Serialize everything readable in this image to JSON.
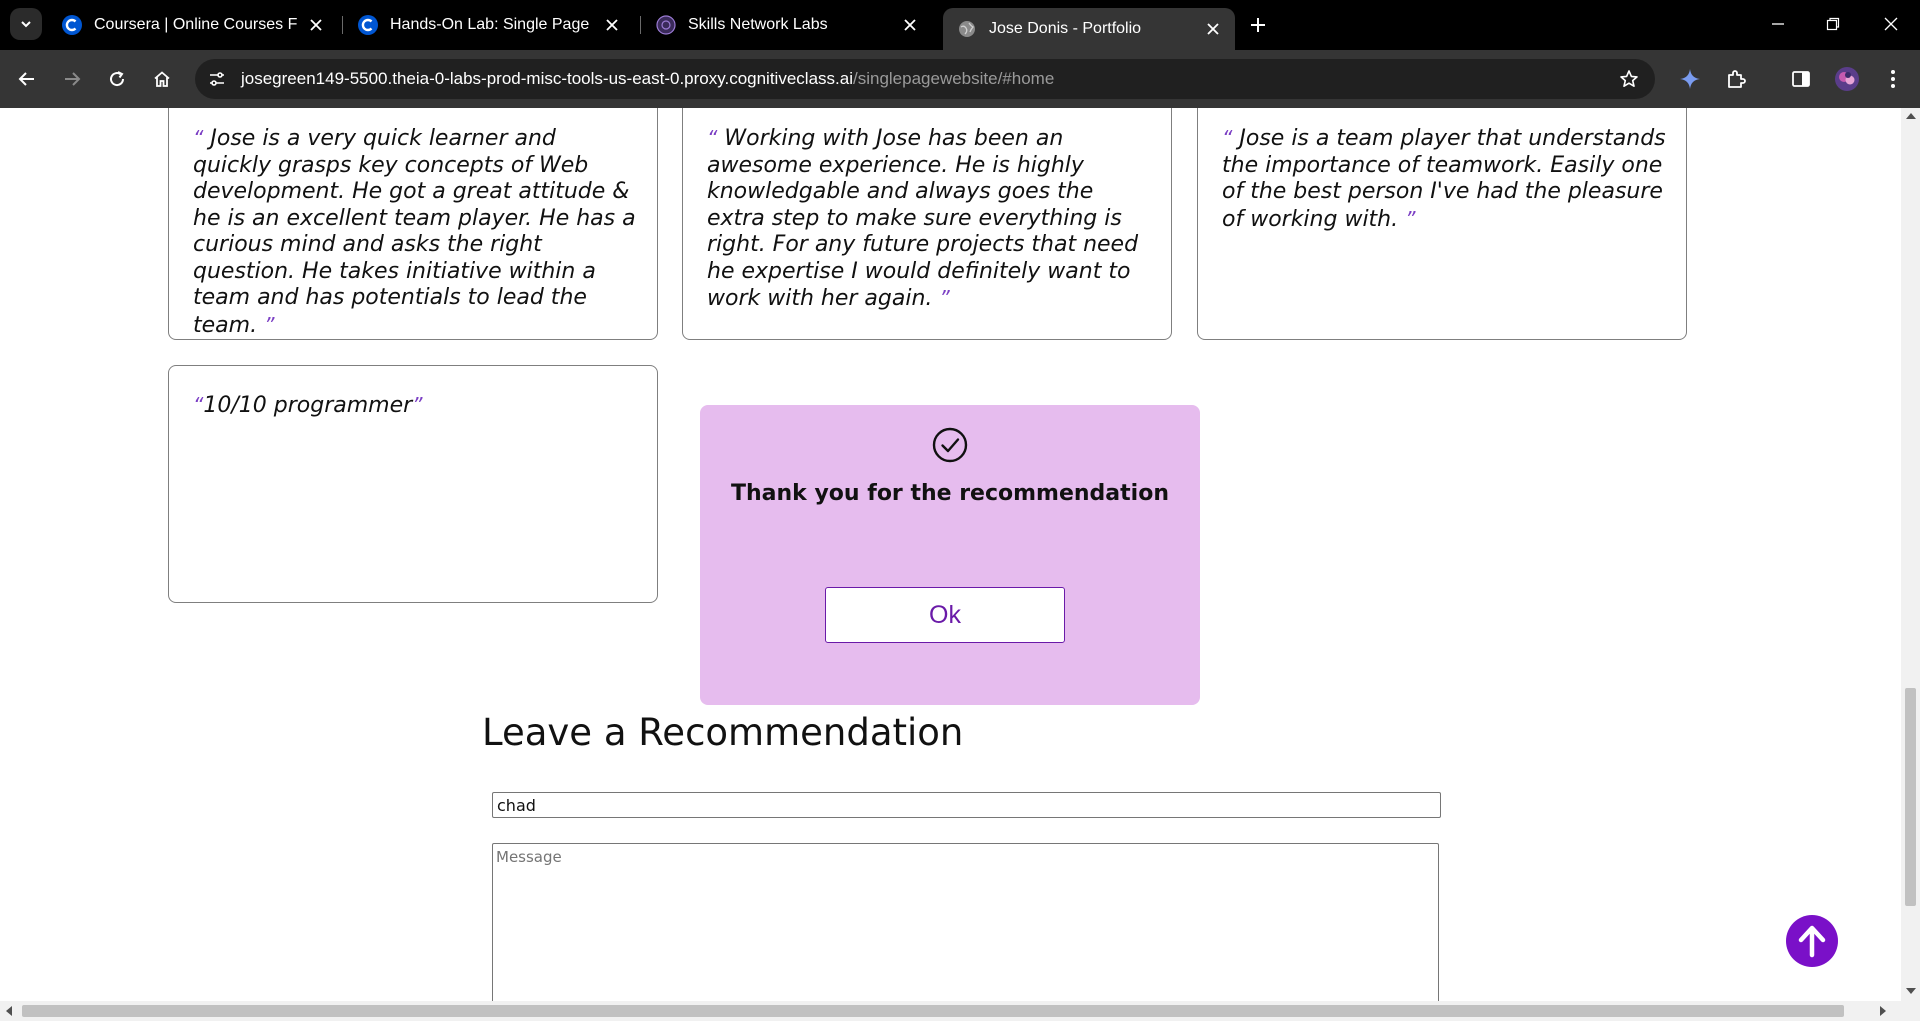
{
  "browser": {
    "tabs": [
      {
        "title": "Coursera | Online Courses From",
        "favicon": "coursera-icon"
      },
      {
        "title": "Hands-On Lab: Single Page Port",
        "favicon": "coursera-icon"
      },
      {
        "title": "Skills Network Labs",
        "favicon": "skills-network-icon"
      },
      {
        "title": "Jose Donis - Portfolio",
        "favicon": "globe-icon",
        "active": true
      }
    ],
    "url_host": "josegreen149-5500.theia-0-labs-prod-misc-tools-us-east-0.proxy.cognitiveclass.ai",
    "url_path": "/singlepagewebsite/#home"
  },
  "page": {
    "recommendations": [
      {
        "open_quote": "“",
        "text": "Jose is a very quick learner and quickly grasps key concepts of Web development. He got a great attitude & he is an excellent team player. He has a curious mind and asks the right question. He takes initiative within a team and has potentials to lead the team.",
        "close_quote": "”"
      },
      {
        "open_quote": "“",
        "text": "Working with Jose has been an awesome experience. He is highly knowledgable and always goes the extra step to make sure everything is right. For any future projects that need he expertise I would definitely want to work with her again.",
        "close_quote": "”"
      },
      {
        "open_quote": "“",
        "text": "Jose is a team player that understands the importance of teamwork. Easily one of the best person I've had the pleasure of working with.",
        "close_quote": "”"
      },
      {
        "open_quote": "“",
        "text": "10/10 programmer",
        "close_quote": "”"
      }
    ],
    "popup": {
      "message": "Thank you for the recommendation",
      "ok_label": "Ok",
      "icon": "check-circle-icon"
    },
    "form": {
      "title": "Leave a Recommendation",
      "name_value": "chad",
      "message_placeholder": "Message"
    }
  },
  "colors": {
    "accent": "#7a10c8",
    "popup_bg": "#e6bcee",
    "quote_mark": "#7b3fc4"
  }
}
